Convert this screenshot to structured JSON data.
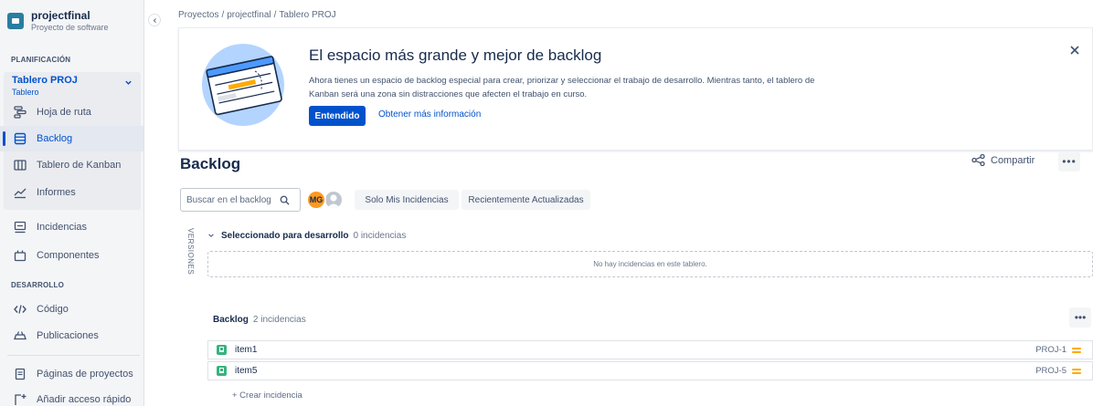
{
  "sidebar": {
    "project_name": "projectfinal",
    "project_type": "Proyecto de software",
    "collapse_icon": "chevron-left-icon",
    "planning_label": "PLANIFICACIÓN",
    "board_name": "Tablero PROJ",
    "board_sub": "Tablero",
    "board_chevron": "chevron-down-icon",
    "items": [
      {
        "label": "Hoja de ruta",
        "icon": "roadmap-icon"
      },
      {
        "label": "Backlog",
        "icon": "backlog-icon",
        "active": true
      },
      {
        "label": "Tablero de Kanban",
        "icon": "kanban-icon"
      },
      {
        "label": "Informes",
        "icon": "reports-icon"
      },
      {
        "label": "Incidencias",
        "icon": "issues-icon"
      },
      {
        "label": "Componentes",
        "icon": "components-icon"
      }
    ],
    "dev_label": "DESARROLLO",
    "dev_items": [
      {
        "label": "Código",
        "icon": "code-icon"
      },
      {
        "label": "Publicaciones",
        "icon": "releases-icon"
      }
    ],
    "bottom_items": [
      {
        "label": "Páginas de proyectos",
        "icon": "page-icon"
      },
      {
        "label": "Añadir acceso rápido",
        "icon": "add-shortcut-icon"
      }
    ]
  },
  "breadcrumb": [
    "Proyectos",
    "projectfinal",
    "Tablero PROJ"
  ],
  "banner": {
    "title": "El espacio más grande y mejor de backlog",
    "text": "Ahora tienes un espacio de backlog especial para crear, priorizar y seleccionar el trabajo de desarrollo. Mientras tanto, el tablero de Kanban será una zona sin distracciones que afecten el trabajo en curso.",
    "primary_label": "Entendido",
    "link_label": "Obtener más información",
    "close_icon": "close-icon"
  },
  "page": {
    "title": "Backlog",
    "share_label": "Compartir",
    "more": "•••"
  },
  "filters": {
    "search_placeholder": "Buscar en el backlog",
    "avatar_initials": "MG",
    "only_mine": "Solo Mis Incidencias",
    "recent": "Recientemente Actualizadas"
  },
  "versions_label": "VERSIONES",
  "selected": {
    "title": "Seleccionado para desarrollo",
    "count": "0 incidencias",
    "empty": "No hay incidencias en este tablero."
  },
  "backlog": {
    "title": "Backlog",
    "count": "2 incidencias",
    "more": "•••",
    "issues": [
      {
        "summary": "item1",
        "key": "PROJ-1"
      },
      {
        "summary": "item5",
        "key": "PROJ-5"
      }
    ],
    "create_label": "+ Crear incidencia"
  },
  "colors": {
    "primary": "#0052cc",
    "story": "#36b37e",
    "priority_medium": "#ffab00",
    "avatar": "#ff991f"
  }
}
